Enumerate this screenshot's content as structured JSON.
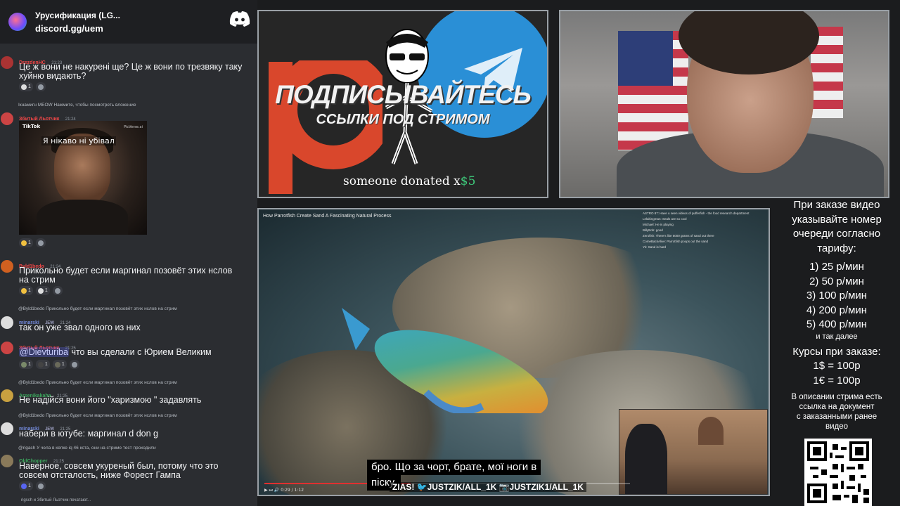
{
  "discord": {
    "server_title": "Урусификация (LG...",
    "invite": "discord.gg/uem",
    "typing": "rigsch и Збитый Льотчик печатают...",
    "messages": [
      {
        "user": "DrezdenHC",
        "time": "21:23",
        "text1": "Це ж вони не накурені ще? Це ж вони по трезвяку таку",
        "text2": "хуйню видають?",
        "reactions": [
          {
            "count": "1"
          },
          {
            "count": ""
          }
        ]
      },
      {
        "reply": "Ікнамигн  MEOW  Нажмите, чтобы посмотреть вложение",
        "user": "Збитый Льотчик",
        "time": "21:24",
        "reactions": [
          {
            "count": "1"
          },
          {
            "count": ""
          }
        ]
      },
      {
        "user": "Byld1bedo",
        "time": "21:24",
        "text1": "Прикольно будет если маргинал позовёт этих нслов",
        "text2": "на стрим",
        "reactions": [
          {
            "count": "1"
          },
          {
            "count": "1"
          },
          {
            "count": ""
          }
        ]
      },
      {
        "reply": "@Byld1bedo Прикольно будет если маргинал позовёт этих нслов на стрим",
        "user": "minarski",
        "badge": "JEW",
        "time": "21:24",
        "text1": "так он уже звал одного из них"
      },
      {
        "user": "Збитый Льотчик",
        "time": "21:25",
        "mention": "@Dievturiba",
        "text1": " что вы сделали с Юрием Великим",
        "reactions": [
          {
            "count": "1"
          },
          {
            "count": "1"
          },
          {
            "count": "1"
          },
          {
            "count": ""
          }
        ]
      },
      {
        "reply": "@Byld1bedo Прикольно будет если маргинал позовёт этих нслов на стрим",
        "user": "Arsenikakaha",
        "time": "21:25",
        "text1": "Не надійся вони його \"харизмою \" задавлять"
      },
      {
        "reply": "@Byld1bedo Прикольно будет если маргинал позовёт этих нслов на стрим",
        "user": "minarski",
        "badge": "JEW",
        "time": "21:25",
        "text1": "набери в ютубе: маргинал d don g"
      },
      {
        "reply": "@rigach У чела в кепке iq 46 кста, они на стриме тест проходили",
        "user": "OldChopper",
        "time": "21:25",
        "text1": "Наверное, совсем укуреный был, потому что это",
        "text2": "совсем отсталость, ниже Форест Гампа",
        "reactions": [
          {
            "count": "1"
          },
          {
            "count": ""
          }
        ]
      }
    ],
    "tiktok": {
      "brand": "TikTok",
      "caption": "Я нікаво ні убівал",
      "watermark": "PicVerse.ai"
    }
  },
  "promo": {
    "line1": "ПОДПИСЫВАЙТЕСЬ",
    "line2": "ССЫЛКИ ПОД СТРИМОМ",
    "donation_prefix": "someone donated x",
    "donation_amount": "$5"
  },
  "video": {
    "title": "How Parrotfish Create Sand A Fascinating Natural Process",
    "subtitle_line1": "бро.  Що за чорт, брате, мої ноги в",
    "subtitle_line2": "піску.",
    "socials": "ZIAS! 🐦JUSTZIK/ALL_1K 📷JUSTZIK1/ALL_1K",
    "time": "0:29 / 1:12",
    "progress": 0.4,
    "overlay_chat": [
      "ASTRO 87: Have u seen videos of pufferfish - the food research department",
      "Lelakingman: Seals are so cool",
      "Michael: He is playing",
      "BillyBob: good",
      "Zerofish: There's like 5000 grams of sand out there",
      "ComeBackAlive: Parrotfish poops out the sand",
      "Yk: Sand is hard"
    ]
  },
  "info": {
    "lines": [
      "При заказе видео",
      "указывайте номер",
      "очереди согласно",
      "тарифу:"
    ],
    "tariffs": [
      "1) 25 р/мин",
      "2) 50 р/мин",
      "3) 100 р/мин",
      "4) 200 р/мин",
      "5) 400 р/мин"
    ],
    "and_more": "и так далее",
    "courses_title": "Курсы при заказе:",
    "courses": [
      "1$ = 100р",
      "1€ = 100р"
    ],
    "note": [
      "В описании стрима есть",
      "ссылка на документ",
      "с заказанными ранее",
      "видео"
    ]
  },
  "colors": {
    "discord_bg": "#2b2d31",
    "discord_header": "#1e1f22",
    "telegram": "#2a8fd6",
    "patreon": "#d9472c",
    "username_red": "#f04747",
    "username_blue": "#7289da"
  }
}
